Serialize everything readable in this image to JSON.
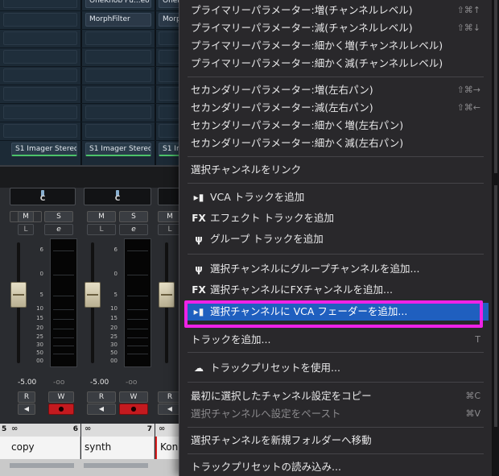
{
  "mixer": {
    "insert_slots": {
      "row0": [
        "OneKnob Pu...eo",
        "OneK"
      ],
      "row1": [
        "MorphFilter",
        "Morph"
      ],
      "row8": [
        "S1 Imager Stereo",
        "S1 Imager Stereo",
        "S1 Im"
      ]
    },
    "pan_labels": [
      "C",
      "C"
    ],
    "mute_label": "M",
    "solo_label": "S",
    "l_label": "L",
    "e_label": "e",
    "meter_scale": [
      "6",
      "0",
      "5",
      "10",
      "15",
      "20",
      "25",
      "30",
      "35",
      "40",
      "50",
      "00"
    ],
    "volume_values": [
      "-5.00",
      "-5.00"
    ],
    "peak_values": [
      "-oo",
      "-oo"
    ],
    "read_label": "R",
    "write_label": "W",
    "speaker_glyph": "◀",
    "rec_glyph": "●",
    "channel_numbers": [
      "5",
      "6",
      "7"
    ],
    "link_glyph": "∞",
    "channel_names": [
      "copy",
      "synth",
      "Kon"
    ]
  },
  "menu": {
    "items": [
      {
        "label": "プライマリーパラメーター:増(チャンネルレベル)",
        "shortcut": "⇧⌘↑"
      },
      {
        "label": "プライマリーパラメーター:減(チャンネルレベル)",
        "shortcut": "⇧⌘↓"
      },
      {
        "label": "プライマリーパラメーター:細かく増(チャンネルレベル)",
        "shortcut": ""
      },
      {
        "label": "プライマリーパラメーター:細かく減(チャンネルレベル)",
        "shortcut": ""
      },
      {
        "label": "セカンダリーパラメーター:増(左右パン)",
        "shortcut": "⇧⌘→"
      },
      {
        "label": "セカンダリーパラメーター:減(左右パン)",
        "shortcut": "⇧⌘←"
      },
      {
        "label": "セカンダリーパラメーター:細かく増(左右パン)",
        "shortcut": ""
      },
      {
        "label": "セカンダリーパラメーター:細かく減(左右パン)",
        "shortcut": ""
      },
      {
        "label": "選択チャンネルをリンク",
        "shortcut": ""
      },
      {
        "label": "VCA トラックを追加",
        "icon": "▸▮",
        "shortcut": ""
      },
      {
        "label": "エフェクト トラックを追加",
        "icon": "FX",
        "shortcut": ""
      },
      {
        "label": "グループ トラックを追加",
        "icon": "ψ",
        "shortcut": ""
      },
      {
        "label": "選択チャンネルにグループチャンネルを追加...",
        "icon": "ψ",
        "shortcut": ""
      },
      {
        "label": "選択チャンネルにFXチャンネルを追加...",
        "icon": "FX",
        "shortcut": ""
      },
      {
        "label": "選択チャンネルに VCA フェーダーを追加...",
        "icon": "▸▮",
        "shortcut": ""
      },
      {
        "label": "トラックを追加...",
        "shortcut": "T"
      },
      {
        "label": "トラックプリセットを使用...",
        "icon": "☁",
        "shortcut": ""
      },
      {
        "label": "最初に選択したチャンネル設定をコピー",
        "shortcut": "⌘C"
      },
      {
        "label": "選択チャンネルへ設定をペースト",
        "shortcut": "⌘V"
      },
      {
        "label": "選択チャンネルを新規フォルダーへ移動",
        "shortcut": ""
      },
      {
        "label": "トラックプリセットの読み込み...",
        "shortcut": ""
      }
    ]
  },
  "colors": {
    "highlight": "#1f5fbf",
    "annotation_box": "#ef22e6",
    "record_button": "#c41a1f",
    "menu_background": "#29282b"
  }
}
